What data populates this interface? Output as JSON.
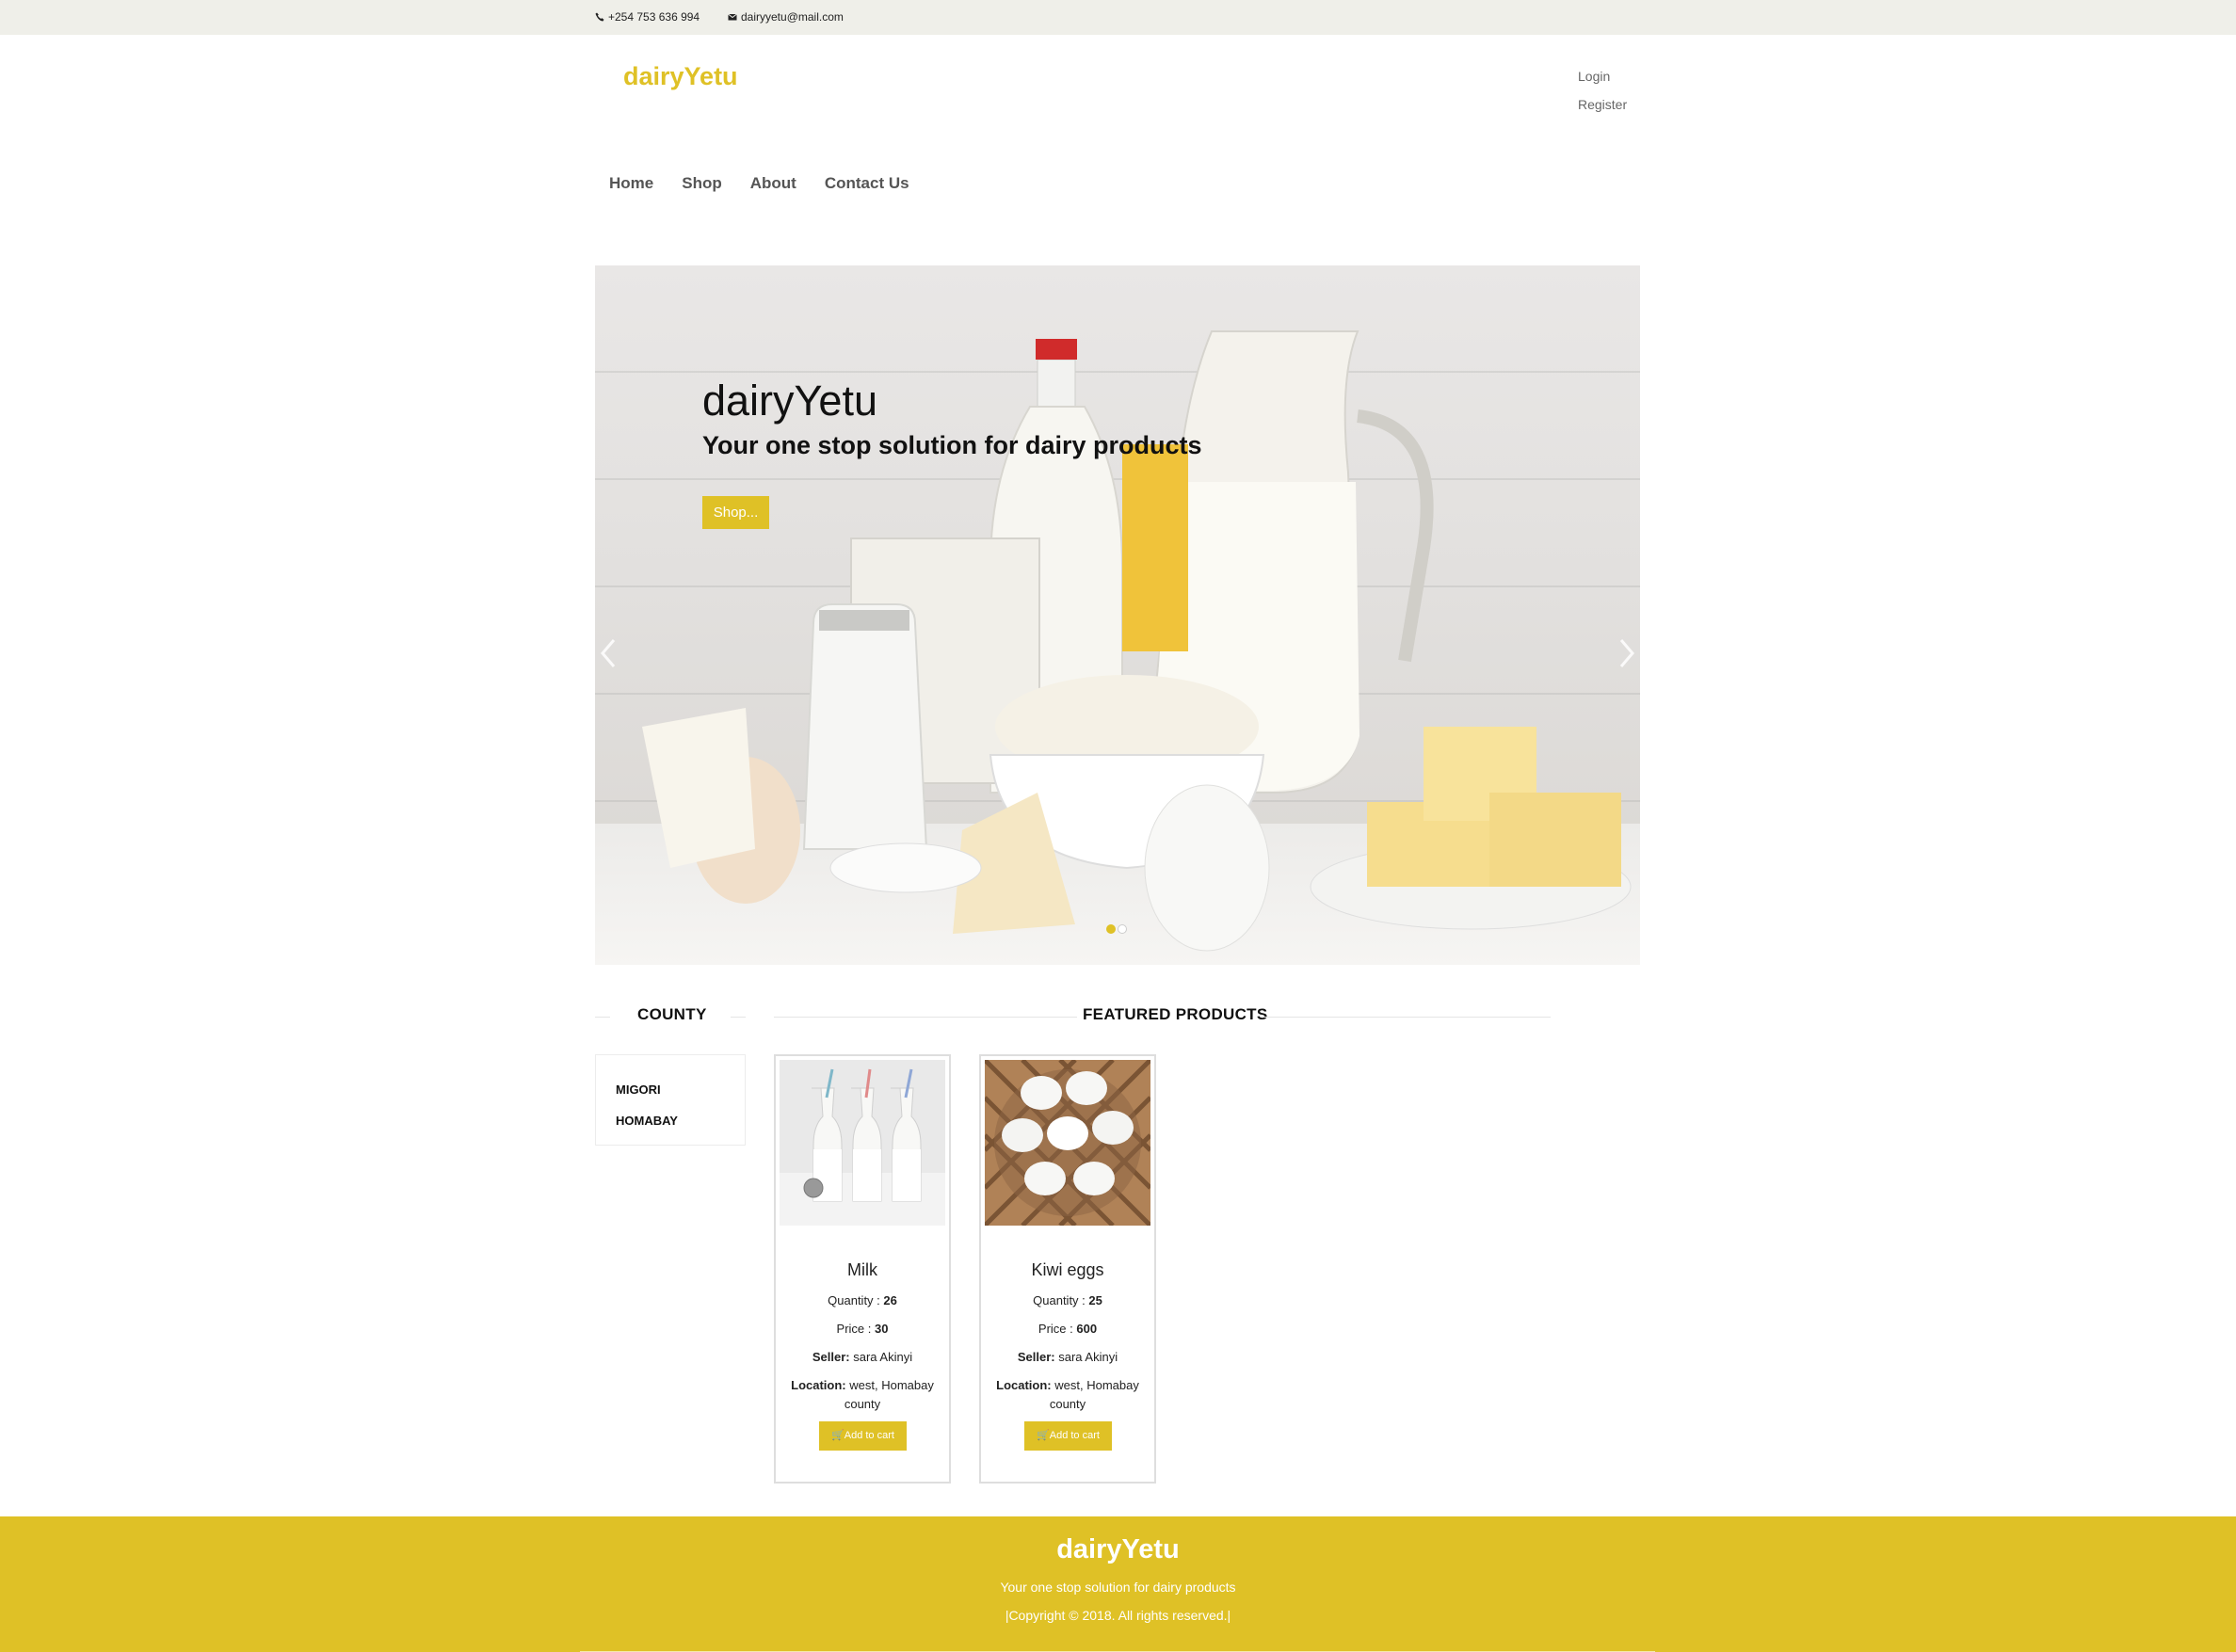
{
  "topbar": {
    "phone": "+254 753 636 994",
    "email": "dairyyetu@mail.com",
    "phone_icon": "phone-icon",
    "email_icon": "envelope-icon"
  },
  "header": {
    "logo": "dairyYetu",
    "login": "Login",
    "register": "Register"
  },
  "nav": {
    "items": [
      "Home",
      "Shop",
      "About",
      "Contact Us"
    ]
  },
  "hero": {
    "title": "dairyYetu",
    "subtitle": "Your one stop solution for dairy products",
    "button": "Shop...",
    "slides": 2,
    "active_slide": 1
  },
  "sidebar": {
    "heading": "COUNTY",
    "items": [
      "MIGORI",
      "HOMABAY"
    ]
  },
  "featured": {
    "heading": "FEATURED PRODUCTS",
    "products": [
      {
        "name": "Milk",
        "quantity_label": "Quantity : ",
        "quantity": "26",
        "price_label": "Price : ",
        "price": "30",
        "seller_label": "Seller:",
        "seller": " sara Akinyi",
        "location_label": "Location:",
        "location": " west, Homabay",
        "location_line2": "county",
        "button": "Add to cart",
        "image_icon": "milk-bottles-image"
      },
      {
        "name": "Kiwi eggs",
        "quantity_label": "Quantity : ",
        "quantity": "25",
        "price_label": "Price : ",
        "price": "600",
        "seller_label": "Seller:",
        "seller": " sara Akinyi",
        "location_label": "Location:",
        "location": " west, Homabay",
        "location_line2": "county",
        "button": "Add to cart",
        "image_icon": "eggs-basket-image"
      }
    ]
  },
  "footer": {
    "title": "dairyYetu",
    "subtitle": "Your one stop solution for dairy products",
    "copyright": "|Copyright © 2018. All rights reserved.|"
  },
  "colors": {
    "accent": "#dfc126",
    "topbar_bg": "#efefe9"
  }
}
